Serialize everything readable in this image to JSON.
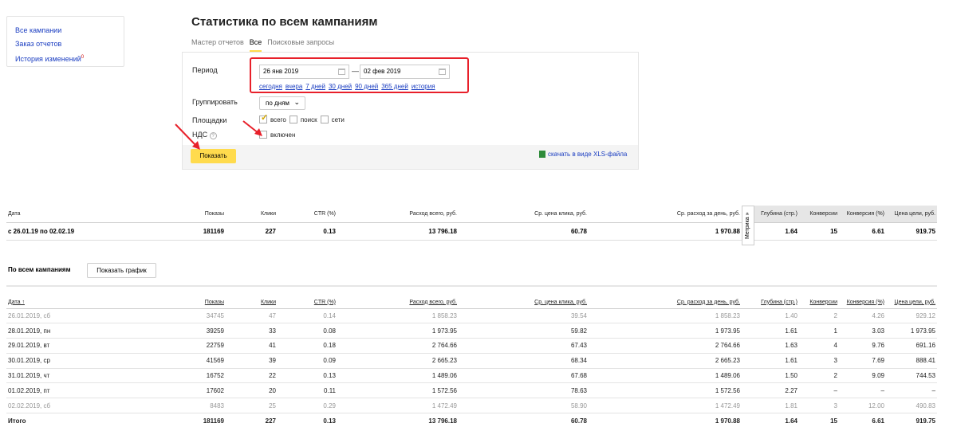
{
  "sidebar": {
    "links": [
      {
        "label": "Все кампании"
      },
      {
        "label": "Заказ отчетов"
      },
      {
        "label": "История изменений",
        "sup": "0"
      }
    ]
  },
  "header": {
    "title": "Статистика по всем кампаниям",
    "tabs": [
      {
        "label": "Мастер отчетов"
      },
      {
        "label": "Все",
        "active": true
      },
      {
        "label": "Поисковые запросы"
      }
    ]
  },
  "form": {
    "period_label": "Период",
    "date_from": "26 янв 2019",
    "date_sep": "—",
    "date_to": "02 фев 2019",
    "quick_ranges": [
      "сегодня",
      "вчера",
      "7 дней",
      "30 дней",
      "90 дней",
      "365 дней",
      "история"
    ],
    "group_label": "Группировать",
    "group_value": "по дням",
    "platforms_label": "Площадки",
    "platforms": [
      {
        "label": "всего",
        "checked": true
      },
      {
        "label": "поиск",
        "checked": false
      },
      {
        "label": "сети",
        "checked": false
      }
    ],
    "vat_label": "НДС",
    "vat_option": "включен",
    "show_button": "Показать",
    "xls_link": "скачать в виде XLS-файла"
  },
  "summary": {
    "headers": [
      "Дата",
      "Показы",
      "Клики",
      "CTR (%)",
      "Расход всего, руб.",
      "Ср. цена клика, руб.",
      "Ср. расход за день, руб.",
      "Глубина (стр.)",
      "Конверсии",
      "Конверсия (%)",
      "Цена цели, руб."
    ],
    "row": [
      "с 26.01.19 по 02.02.19",
      "181169",
      "227",
      "0.13",
      "13 796.18",
      "60.78",
      "1 970.88",
      "1.64",
      "15",
      "6.61",
      "919.75"
    ],
    "metrika_label": "Метрика »"
  },
  "campaigns": {
    "title": "По всем кампаниям",
    "graph_button": "Показать график",
    "headers": [
      "Дата ↑",
      "Показы",
      "Клики",
      "CTR (%)",
      "Расход всего, руб.",
      "Ср. цена клика, руб.",
      "Ср. расход за день, руб.",
      "Глубина (стр.)",
      "Конверсии",
      "Конверсия (%)",
      "Цена цели, руб."
    ],
    "rows": [
      {
        "weekend": true,
        "cells": [
          "26.01.2019, сб",
          "34745",
          "47",
          "0.14",
          "1 858.23",
          "39.54",
          "1 858.23",
          "1.40",
          "2",
          "4.26",
          "929.12"
        ]
      },
      {
        "weekend": false,
        "cells": [
          "28.01.2019, пн",
          "39259",
          "33",
          "0.08",
          "1 973.95",
          "59.82",
          "1 973.95",
          "1.61",
          "1",
          "3.03",
          "1 973.95"
        ]
      },
      {
        "weekend": false,
        "cells": [
          "29.01.2019, вт",
          "22759",
          "41",
          "0.18",
          "2 764.66",
          "67.43",
          "2 764.66",
          "1.63",
          "4",
          "9.76",
          "691.16"
        ]
      },
      {
        "weekend": false,
        "cells": [
          "30.01.2019, ср",
          "41569",
          "39",
          "0.09",
          "2 665.23",
          "68.34",
          "2 665.23",
          "1.61",
          "3",
          "7.69",
          "888.41"
        ]
      },
      {
        "weekend": false,
        "cells": [
          "31.01.2019, чт",
          "16752",
          "22",
          "0.13",
          "1 489.06",
          "67.68",
          "1 489.06",
          "1.50",
          "2",
          "9.09",
          "744.53"
        ]
      },
      {
        "weekend": false,
        "cells": [
          "01.02.2019, пт",
          "17602",
          "20",
          "0.11",
          "1 572.56",
          "78.63",
          "1 572.56",
          "2.27",
          "–",
          "–",
          "–"
        ]
      },
      {
        "weekend": true,
        "cells": [
          "02.02.2019, сб",
          "8483",
          "25",
          "0.29",
          "1 472.49",
          "58.90",
          "1 472.49",
          "1.81",
          "3",
          "12.00",
          "490.83"
        ]
      }
    ],
    "total": [
      "Итого",
      "181169",
      "227",
      "0.13",
      "13 796.18",
      "60.78",
      "1 970.88",
      "1.64",
      "15",
      "6.61",
      "919.75"
    ]
  },
  "colors": {
    "accent": "#ffdb4d",
    "link": "#1a3dc1",
    "annotation": "#e8202a"
  }
}
